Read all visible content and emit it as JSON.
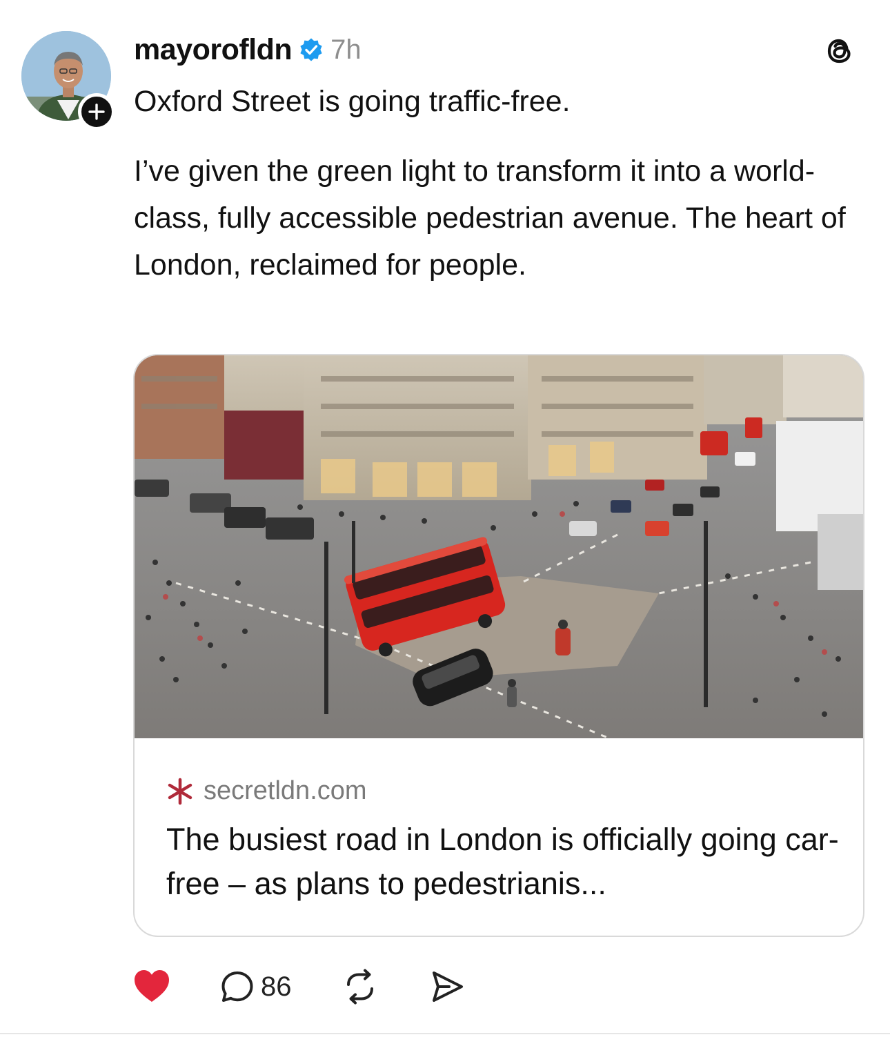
{
  "post": {
    "username": "mayorofldn",
    "verified": true,
    "timestamp": "7h",
    "paragraphs": [
      "Oxford Street is going traffic-free.",
      "I’ve given the green light to transform it into a world-class, fully accessible pedestrian avenue. The heart of London, reclaimed for people."
    ]
  },
  "link_card": {
    "site_domain": "secretldn.com",
    "site_icon": "asterisk-icon",
    "title": "The busiest road in London is officially going car-free – as plans to pedestrianis..."
  },
  "actions": {
    "liked": true,
    "like_color": "#e3263c",
    "reply_count": "86"
  },
  "icons": {
    "follow": "plus-icon",
    "verified": "verified-badge-icon",
    "app": "threads-logo-icon",
    "like": "heart-icon",
    "reply": "speech-bubble-icon",
    "repost": "repost-icon",
    "share": "send-icon"
  },
  "colors": {
    "verified_blue": "#1d9bf0",
    "site_icon_red": "#b02a3a",
    "muted_text": "#8e8e8e"
  }
}
